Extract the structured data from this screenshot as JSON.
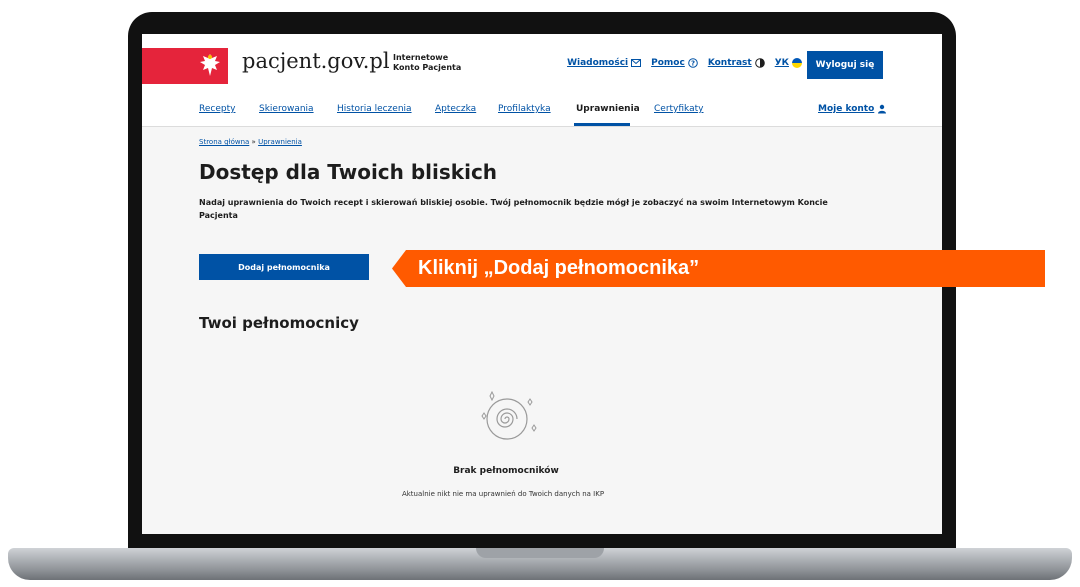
{
  "header": {
    "logo": "pacjent.gov.pl",
    "subtitle_line1": "Internetowe",
    "subtitle_line2": "Konto Pacjenta",
    "links": [
      {
        "label": "Wiadomości",
        "icon": "mail-icon"
      },
      {
        "label": "Pomoc",
        "icon": "help-icon"
      },
      {
        "label": "Kontrast",
        "icon": "contrast-icon"
      },
      {
        "label": "УК",
        "icon": "ukraine-flag-icon"
      }
    ],
    "logout": "Wyloguj się"
  },
  "nav": {
    "items": [
      "Recepty",
      "Skierowania",
      "Historia leczenia",
      "Apteczka",
      "Profilaktyka",
      "Uprawnienia",
      "Certyfikaty"
    ],
    "active": "Uprawnienia",
    "account": "Moje konto"
  },
  "breadcrumb": {
    "home": "Strona główna",
    "separator": "»",
    "current": "Uprawnienia"
  },
  "main": {
    "title": "Dostęp dla Twoich bliskich",
    "description": "Nadaj uprawnienia do Twoich recept i skierowań bliskiej osobie. Twój pełnomocnik będzie mógł je zobaczyć na swoim Internetowym Koncie Pacjenta",
    "add_button": "Dodaj pełnomocnika",
    "section_title": "Twoi pełnomocnicy",
    "empty_title": "Brak pełnomocników",
    "empty_desc": "Aktualnie nikt nie ma uprawnień do Twoich danych na IKP"
  },
  "callout": {
    "text": "Kliknij „Dodaj pełnomocnika”"
  },
  "colors": {
    "primary": "#0052a5",
    "flag_red": "#e5243b",
    "callout": "#ff5a00"
  }
}
